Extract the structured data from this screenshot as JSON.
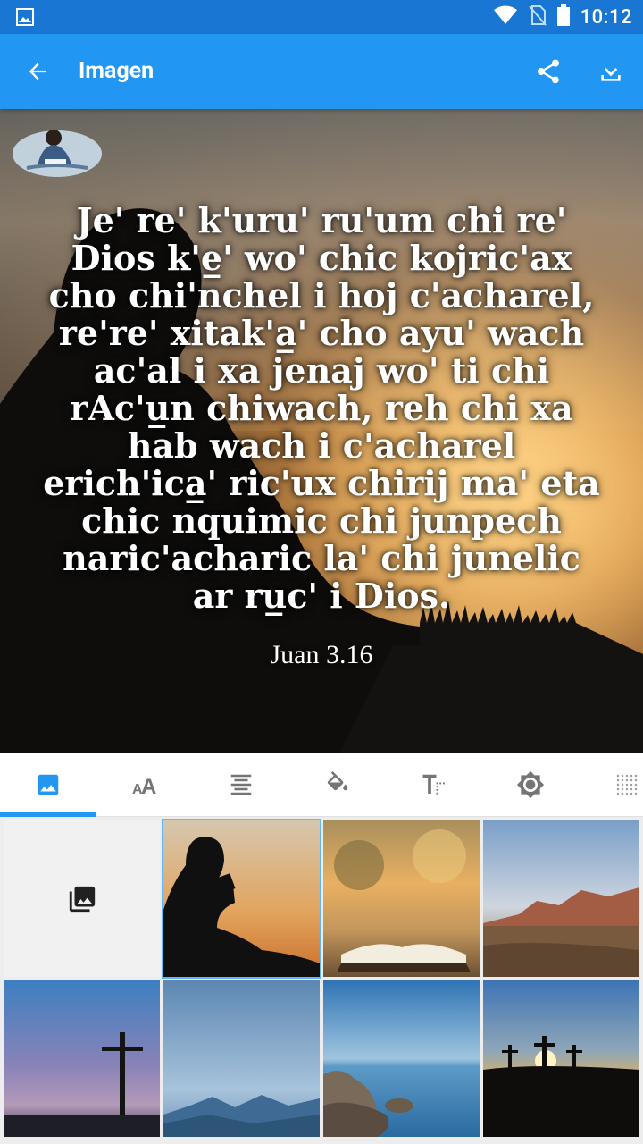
{
  "status_bar": {
    "time": "10:12",
    "icons": [
      "image-icon",
      "wifi-icon",
      "no-sim-icon",
      "battery-icon"
    ]
  },
  "app_bar": {
    "title": "Imagen",
    "actions": [
      "share-icon",
      "download-icon"
    ]
  },
  "preview": {
    "verse": "Je' re' k'uru' ru'um chi re'\nDios k'e̲' wo' chic kojric'ax\ncho chi'nchel i hoj c'acharel,\nre're' xitak'a̲' cho ayu' wach\nac'al i xa jenaj wo' ti chi\nrAc'u̲n chiwach, reh chi xa\nhab wach i c'acharel\nerich'ica̲' ric'ux chirij ma' eta\nchic nquimic chi junpech\nnaric'acharic la' chi junelic\nar ru̲c' i Dios.",
    "reference": "Juan 3.16"
  },
  "tabs": [
    {
      "icon": "image-icon",
      "active": true
    },
    {
      "icon": "font-size-icon",
      "active": false
    },
    {
      "icon": "align-center-icon",
      "active": false
    },
    {
      "icon": "paint-bucket-icon",
      "active": false
    },
    {
      "icon": "text-format-icon",
      "active": false
    },
    {
      "icon": "brightness-icon",
      "active": false
    },
    {
      "icon": "texture-icon",
      "active": false
    }
  ],
  "gallery": {
    "picker_icon": "photo-library-icon",
    "thumbnails": [
      {
        "name": "boy-reading-silhouette",
        "selected": true
      },
      {
        "name": "open-bible-blur"
      },
      {
        "name": "desert-mountains"
      },
      {
        "name": "cross-at-dusk"
      },
      {
        "name": "blue-mountains"
      },
      {
        "name": "sea-rocks"
      },
      {
        "name": "three-crosses-sunset"
      }
    ]
  },
  "colors": {
    "status_bar": "#1976d2",
    "app_bar": "#2196f3",
    "accent": "#2196f3",
    "selected_outline": "#64b5f6"
  }
}
